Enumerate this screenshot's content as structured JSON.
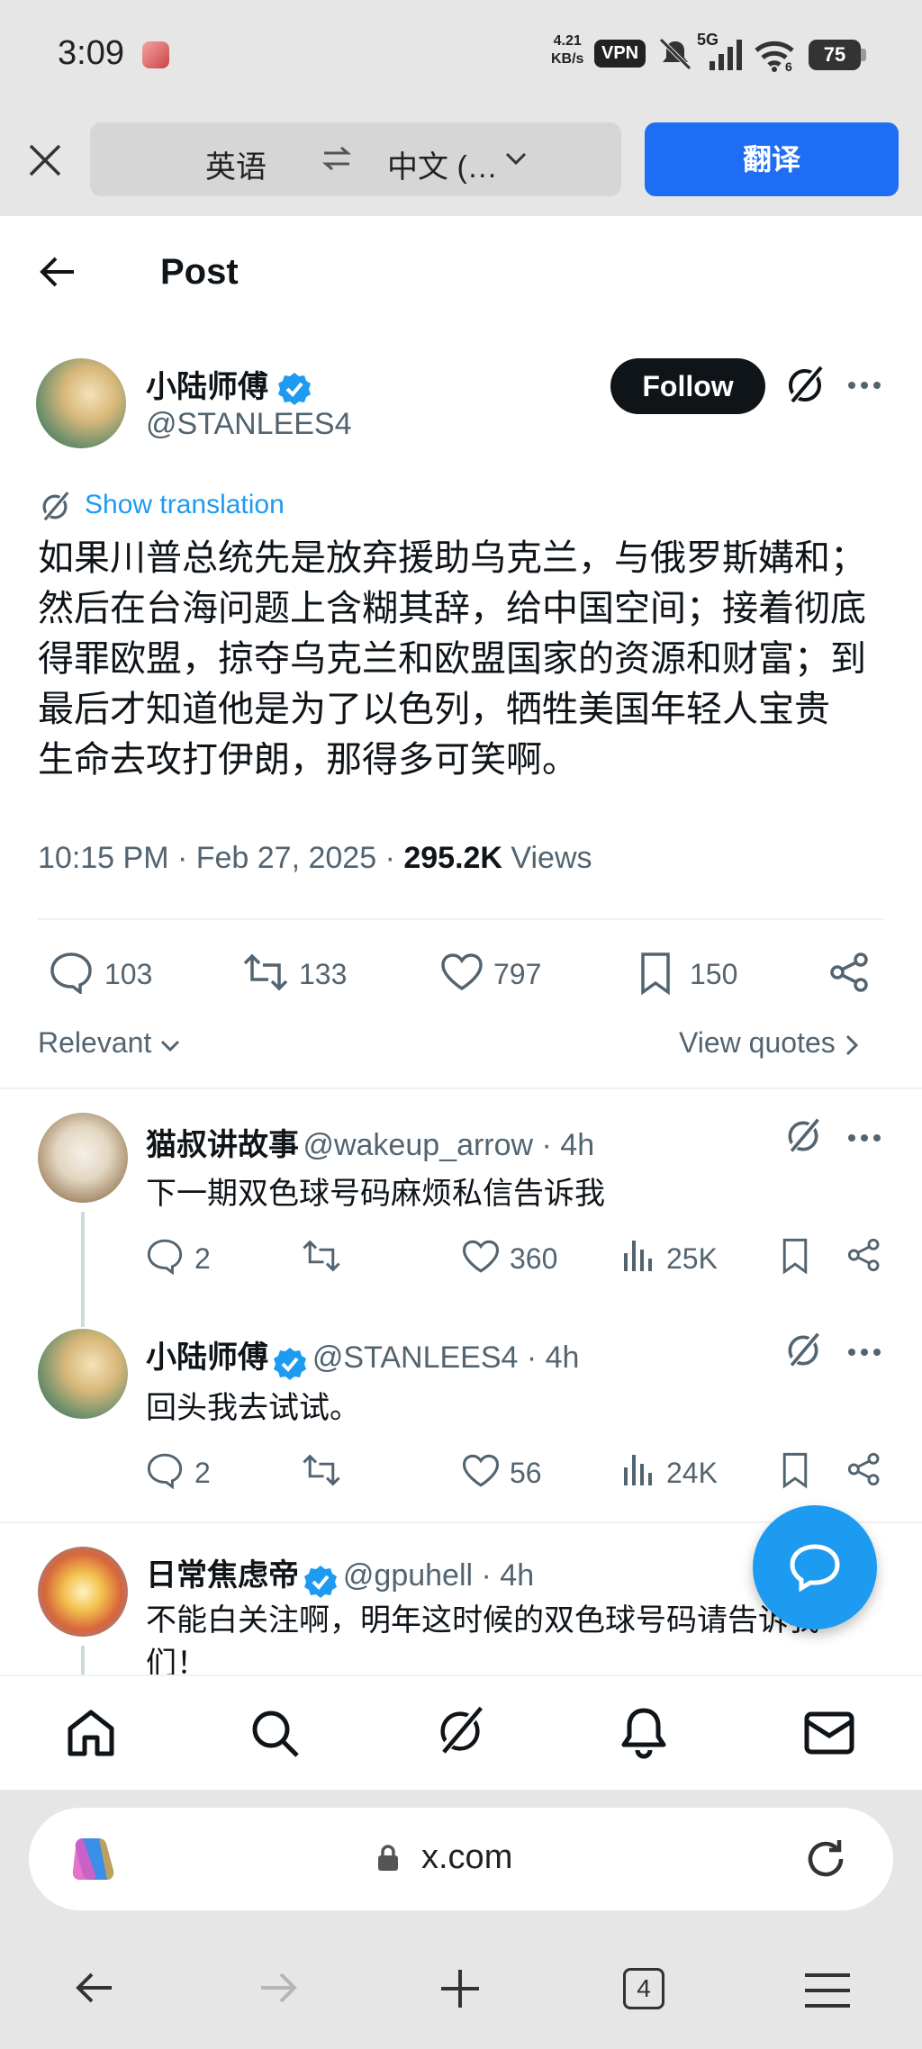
{
  "status_bar": {
    "time": "3:09",
    "net_speed_value": "4.21",
    "net_speed_unit": "KB/s",
    "vpn": "VPN",
    "signal": "5G",
    "wifi_sub": "6",
    "battery": "75"
  },
  "translate_bar": {
    "source_lang": "英语",
    "target_lang": "中文 (…",
    "translate_button": "翻译"
  },
  "header": {
    "title": "Post"
  },
  "post": {
    "author_name": "小陆师傅",
    "author_handle": "@STANLEES4",
    "follow_label": "Follow",
    "show_translation": "Show translation",
    "text_lines": [
      "如果川普总统先是放弃援助乌克兰，与俄罗斯媾和；",
      "然后在台海问题上含糊其辞，给中国空间；接着彻底",
      "得罪欧盟，掠夺乌克兰和欧盟国家的资源和财富；到",
      "最后才知道他是为了以色列，牺牲美国年轻人宝贵",
      "生命去攻打伊朗，那得多可笑啊。"
    ],
    "time_date": "10:15 PM · Feb 27, 2025 · ",
    "views_count": "295.2K",
    "views_label": " Views",
    "stats": {
      "replies": "103",
      "reposts": "133",
      "likes": "797",
      "bookmarks": "150"
    },
    "sort_label": "Relevant",
    "view_quotes": "View quotes"
  },
  "replies": [
    {
      "name": "猫叔讲故事",
      "handle": "@wakeup_arrow · 4h",
      "text": "下一期双色球号码麻烦私信告诉我",
      "replies": "2",
      "likes": "360",
      "views": "25K"
    },
    {
      "name": "小陆师傅",
      "handle": "@STANLEES4 · 4h",
      "text": "回头我去试试。",
      "replies": "2",
      "likes": "56",
      "views": "24K"
    },
    {
      "name": "日常焦虑帝",
      "handle": "@gpuhell · 4h",
      "text_lines": [
        "不能白关注啊，明年这时候的双色球号码请告诉我",
        "们！"
      ]
    }
  ],
  "browser": {
    "url": "x.com",
    "tab_count": "4"
  },
  "colors": {
    "accent_blue": "#1d9bf0",
    "translate_blue": "#1d6ef5",
    "text_primary": "#0f1419",
    "text_secondary": "#536471"
  }
}
